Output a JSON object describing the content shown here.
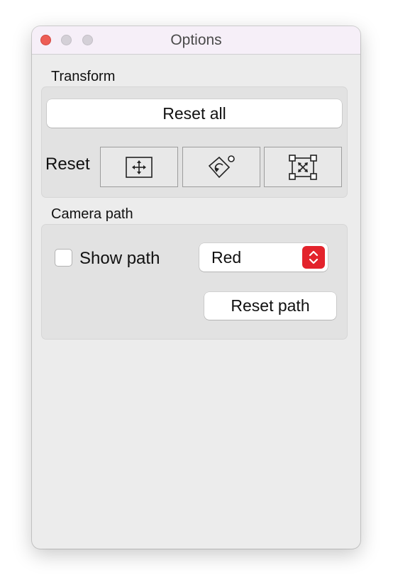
{
  "window": {
    "title": "Options",
    "traffic_lights": {
      "close_color": "#ed5d56",
      "minimize_color": "#d4d0d7",
      "zoom_color": "#d4d0d7"
    }
  },
  "transform": {
    "section_label": "Transform",
    "reset_all_label": "Reset",
    "reset_all_text": "Reset all",
    "reset_label": "Reset",
    "icon_buttons": [
      {
        "icon": "move-icon"
      },
      {
        "icon": "rotate-icon"
      },
      {
        "icon": "scale-icon"
      }
    ]
  },
  "camera_path": {
    "section_label": "Camera path",
    "show_path_label": "Show path",
    "show_path_checked": false,
    "color_selected": "Red",
    "accent_color": "#e3232c",
    "reset_path_label": "Reset path"
  }
}
